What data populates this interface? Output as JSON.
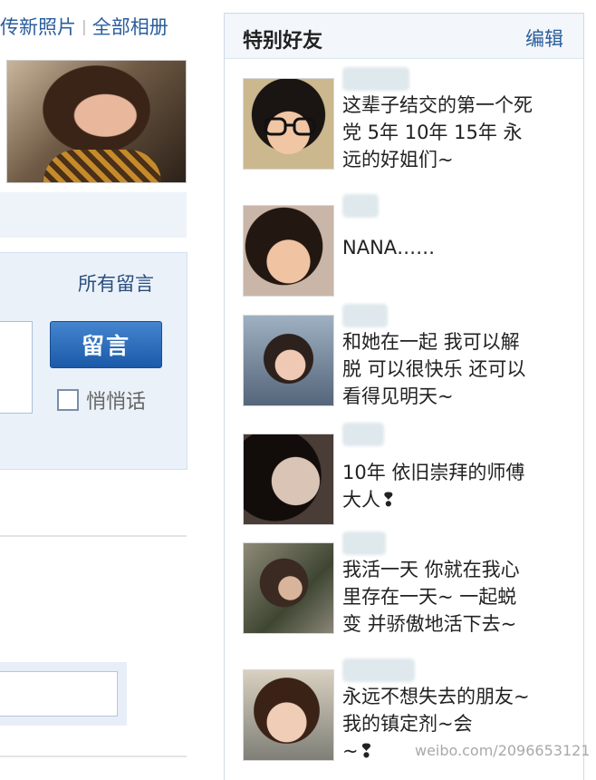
{
  "photo_links": {
    "upload": "传新照片",
    "separator": "|",
    "all_albums": "全部相册"
  },
  "guestbook": {
    "all_messages": "所有留言",
    "leave_message_button": "留言",
    "whisper_label": "悄悄话",
    "whisper_checked": false
  },
  "special_friends": {
    "title": "特别好友",
    "edit_label": "编辑",
    "friends": [
      {
        "message": "这辈子结交的第一个死\n党 5年 10年 15年 永\n远的好姐们~"
      },
      {
        "message": "NANA……"
      },
      {
        "message": "和她在一起 我可以解\n脱 可以很快乐 还可以\n看得见明天~"
      },
      {
        "message": "10年 依旧崇拜的师傅\n大人❢"
      },
      {
        "message": "我活一天 你就在我心\n里存在一天~ 一起蜕\n变 并骄傲地活下去~"
      },
      {
        "message": "永远不想失去的朋友~\n我的镇定剂~会\n~❢"
      }
    ]
  },
  "watermark": "weibo.com/2096653121",
  "colors": {
    "link": "#2a5d9c",
    "button": "#1a5aa8",
    "panel_header": "#f3f6fa"
  }
}
